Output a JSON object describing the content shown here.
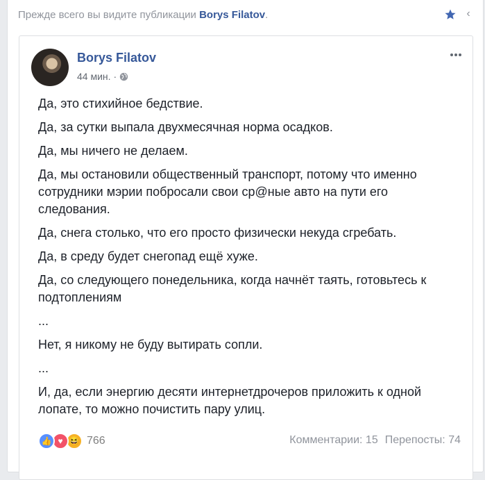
{
  "header": {
    "see_first_prefix": "Прежде всего вы видите публикации",
    "see_first_name": "Borys Filatov",
    "see_first_suffix": ".",
    "close_symbol": "‹"
  },
  "post": {
    "author": "Borys Filatov",
    "time": "44 мин.",
    "privacy_icon": "globe-icon",
    "paragraphs": [
      "Да, это стихийное бедствие.",
      "Да, за сутки выпала двухмесячная норма осадков.",
      "Да, мы ничего не делаем.",
      "Да, мы остановили общественный транспорт, потому что именно сотрудники мэрии побросали свои ср@ные авто на пути его следования.",
      "Да, снега столько, что его просто физически некуда сгребать.",
      "Да, в среду будет снегопад ещё хуже.",
      "Да, со следующего понедельника, когда начнёт таять, готовьтесь к подтоплениям",
      "...",
      "Нет, я никому не буду вытирать сопли.",
      "...",
      "И, да, если энергию десяти интернетдрочеров приложить к одной лопате, то можно почистить пару улиц."
    ],
    "reactions": {
      "icons": [
        "like-icon",
        "love-icon",
        "haha-icon"
      ],
      "like_glyph": "👍",
      "love_glyph": "♥",
      "haha_glyph": "😆",
      "count": "766"
    },
    "comments": "Комментарии: 15",
    "shares": "Перепосты: 74"
  },
  "colors": {
    "link": "#365899",
    "star": "#4267b2",
    "background": "#e9ebee"
  }
}
